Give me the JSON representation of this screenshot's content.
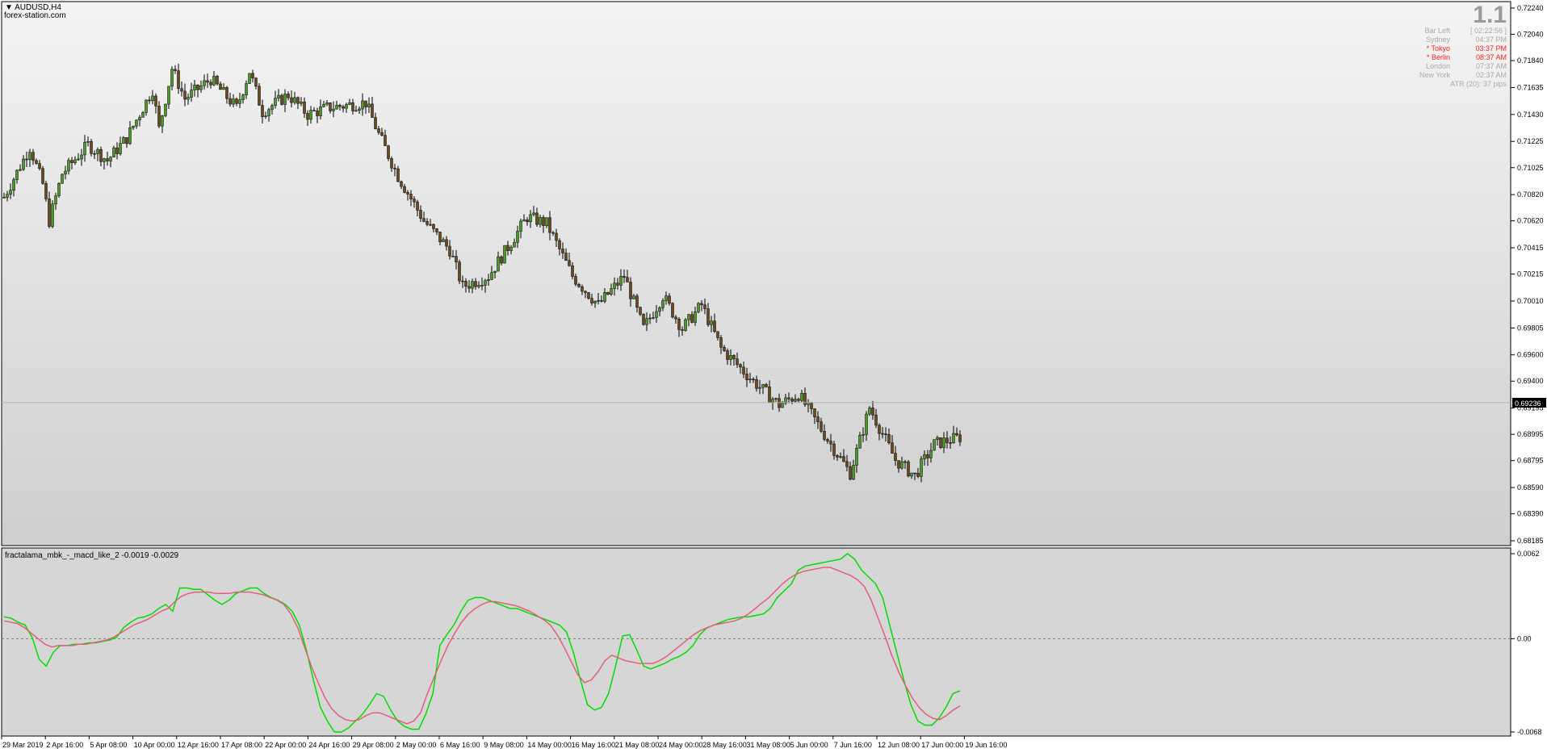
{
  "window": {
    "symbol": "AUDUSD,H4",
    "broker": "forex-station.com",
    "spread": "1.1"
  },
  "sessions": {
    "rows": [
      {
        "label": "Bar Left",
        "value": "[ 02:22:56 ]",
        "color": "#a9a9a9"
      },
      {
        "label": "Sydney",
        "value": "04:37 PM",
        "color": "#a9a9a9"
      },
      {
        "label": "* Tokyo",
        "value": "03:37 PM",
        "color": "#ff2020"
      },
      {
        "label": "* Berlin",
        "value": "08:37 AM",
        "color": "#ff2020"
      },
      {
        "label": "London",
        "value": "07:37 AM",
        "color": "#a9a9a9"
      },
      {
        "label": "New York",
        "value": "02:37 AM",
        "color": "#a9a9a9"
      }
    ],
    "atr": "ATR (20): 37 pips"
  },
  "indicator": {
    "title": "fractalama_mbk_-_macd_like_2 -0.0019 -0.0029"
  },
  "chart_data": [
    {
      "type": "candlestick",
      "title": "AUDUSD,H4",
      "ylim": [
        0.68185,
        0.7224
      ],
      "y_ticks": [
        "0.72240",
        "0.72040",
        "0.71840",
        "0.71635",
        "0.71430",
        "0.71225",
        "0.71025",
        "0.70820",
        "0.70620",
        "0.70415",
        "0.70215",
        "0.70010",
        "0.69805",
        "0.69600",
        "0.69400",
        "0.69195",
        "0.68995",
        "0.68795",
        "0.68590",
        "0.68390",
        "0.68185"
      ],
      "current_price": "0.69236",
      "bar_count": 297,
      "bullish_color": "#4c9a2a",
      "bearish_color": "#6b4a1e",
      "anchors": [
        [
          0,
          0.708
        ],
        [
          8,
          0.7118
        ],
        [
          12,
          0.709
        ],
        [
          14,
          0.7062
        ],
        [
          18,
          0.7098
        ],
        [
          26,
          0.712
        ],
        [
          32,
          0.7108
        ],
        [
          38,
          0.7125
        ],
        [
          46,
          0.7162
        ],
        [
          48,
          0.7132
        ],
        [
          52,
          0.7178
        ],
        [
          56,
          0.7155
        ],
        [
          64,
          0.717
        ],
        [
          72,
          0.7148
        ],
        [
          76,
          0.7176
        ],
        [
          80,
          0.7145
        ],
        [
          88,
          0.7158
        ],
        [
          94,
          0.7143
        ],
        [
          100,
          0.7148
        ],
        [
          112,
          0.7152
        ],
        [
          116,
          0.7128
        ],
        [
          122,
          0.7096
        ],
        [
          130,
          0.7062
        ],
        [
          138,
          0.704
        ],
        [
          142,
          0.7012
        ],
        [
          150,
          0.702
        ],
        [
          156,
          0.7042
        ],
        [
          162,
          0.7065
        ],
        [
          168,
          0.706
        ],
        [
          176,
          0.702
        ],
        [
          184,
          0.6998
        ],
        [
          192,
          0.702
        ],
        [
          198,
          0.698
        ],
        [
          204,
          0.7005
        ],
        [
          210,
          0.698
        ],
        [
          216,
          0.6998
        ],
        [
          222,
          0.6965
        ],
        [
          232,
          0.694
        ],
        [
          240,
          0.6922
        ],
        [
          246,
          0.693
        ],
        [
          256,
          0.6892
        ],
        [
          262,
          0.687
        ],
        [
          268,
          0.692
        ],
        [
          276,
          0.688
        ],
        [
          282,
          0.6868
        ],
        [
          288,
          0.6892
        ],
        [
          297,
          0.6898
        ]
      ]
    },
    {
      "type": "line",
      "title": "fractalama_mbk_-_macd_like_2 -0.0019 -0.0029",
      "ylim": [
        -0.0068,
        0.0062
      ],
      "y_ticks": [
        "0.0062",
        "0.00",
        "-0.0068"
      ],
      "zero_line": 0.0,
      "series": [
        {
          "color": "#00dd00",
          "values": [
            0.0016,
            0.0015,
            0.0012,
            0.001,
            0.0001,
            -0.0015,
            -0.002,
            -0.001,
            -0.0005,
            -0.0005,
            -0.0004,
            -0.0004,
            -0.0003,
            -0.0003,
            -0.0002,
            -0.0001,
            0.0001,
            0.0008,
            0.0012,
            0.0015,
            0.0016,
            0.0018,
            0.0022,
            0.0025,
            0.002,
            0.0037,
            0.0037,
            0.0036,
            0.0036,
            0.0032,
            0.0028,
            0.0025,
            0.0028,
            0.0033,
            0.0035,
            0.0037,
            0.0037,
            0.0033,
            0.003,
            0.0028,
            0.0025,
            0.002,
            0.001,
            -0.0008,
            -0.003,
            -0.005,
            -0.006,
            -0.0068,
            -0.0068,
            -0.0065,
            -0.006,
            -0.0055,
            -0.0048,
            -0.004,
            -0.0042,
            -0.0052,
            -0.006,
            -0.0064,
            -0.0066,
            -0.0066,
            -0.0055,
            -0.004,
            -0.0005,
            0.0003,
            0.001,
            0.002,
            0.0028,
            0.003,
            0.003,
            0.0028,
            0.0026,
            0.0024,
            0.0022,
            0.0022,
            0.002,
            0.0018,
            0.0016,
            0.0014,
            0.0012,
            0.001,
            0.0005,
            -0.001,
            -0.003,
            -0.0048,
            -0.0052,
            -0.005,
            -0.004,
            -0.002,
            0.0002,
            0.0003,
            -0.0008,
            -0.002,
            -0.0022,
            -0.002,
            -0.0018,
            -0.0015,
            -0.0013,
            -0.001,
            -0.0005,
            0.0003,
            0.0008,
            0.001,
            0.0012,
            0.0014,
            0.0015,
            0.0016,
            0.0016,
            0.0017,
            0.0018,
            0.0022,
            0.003,
            0.0035,
            0.004,
            0.005,
            0.0053,
            0.0054,
            0.0055,
            0.0056,
            0.0057,
            0.0058,
            0.0062,
            0.0058,
            0.005,
            0.0045,
            0.004,
            0.003,
            0.001,
            -0.001,
            -0.003,
            -0.0048,
            -0.006,
            -0.0063,
            -0.0063,
            -0.0058,
            -0.005,
            -0.004,
            -0.0038
          ]
        },
        {
          "color": "#e0607a",
          "values": [
            0.0013,
            0.0012,
            0.0011,
            0.0008,
            0.0004,
            0.0,
            -0.0004,
            -0.0006,
            -0.0005,
            -0.0005,
            -0.0005,
            -0.0004,
            -0.0004,
            -0.0003,
            -0.0002,
            -0.0001,
            0.0001,
            0.0004,
            0.0007,
            0.001,
            0.0012,
            0.0014,
            0.0017,
            0.002,
            0.0022,
            0.0027,
            0.0031,
            0.0033,
            0.0034,
            0.0034,
            0.0034,
            0.0033,
            0.0033,
            0.0033,
            0.0034,
            0.0034,
            0.0034,
            0.0033,
            0.0032,
            0.003,
            0.0028,
            0.0025,
            0.0018,
            0.0008,
            -0.0006,
            -0.002,
            -0.0032,
            -0.0043,
            -0.0051,
            -0.0056,
            -0.0059,
            -0.006,
            -0.0059,
            -0.0056,
            -0.0054,
            -0.0054,
            -0.0056,
            -0.0058,
            -0.006,
            -0.0062,
            -0.006,
            -0.0054,
            -0.004,
            -0.0028,
            -0.0016,
            -0.0005,
            0.0004,
            0.0012,
            0.0018,
            0.0022,
            0.0025,
            0.0027,
            0.0027,
            0.0026,
            0.0025,
            0.0024,
            0.0022,
            0.002,
            0.0017,
            0.0014,
            0.001,
            0.0003,
            -0.0006,
            -0.0016,
            -0.0026,
            -0.0032,
            -0.003,
            -0.0024,
            -0.0016,
            -0.0012,
            -0.0014,
            -0.0016,
            -0.0017,
            -0.0018,
            -0.0018,
            -0.0018,
            -0.0016,
            -0.0013,
            -0.0009,
            -0.0005,
            -0.0001,
            0.0003,
            0.0006,
            0.0008,
            0.001,
            0.0011,
            0.0012,
            0.0013,
            0.0015,
            0.0018,
            0.0022,
            0.0026,
            0.003,
            0.0035,
            0.004,
            0.0044,
            0.0047,
            0.0049,
            0.005,
            0.0051,
            0.0052,
            0.0052,
            0.005,
            0.0048,
            0.0046,
            0.0043,
            0.0038,
            0.0028,
            0.0015,
            0.0002,
            -0.0012,
            -0.0024,
            -0.0034,
            -0.0043,
            -0.005,
            -0.0055,
            -0.0058,
            -0.0059,
            -0.0056,
            -0.0052,
            -0.0049
          ]
        }
      ]
    }
  ],
  "x_axis_labels": [
    "29 Mar 2019",
    "2 Apr 16:00",
    "5 Apr 08:00",
    "10 Apr 00:00",
    "12 Apr 16:00",
    "17 Apr 08:00",
    "22 Apr 00:00",
    "24 Apr 16:00",
    "29 Apr 08:00",
    "2 May 00:00",
    "6 May 16:00",
    "9 May 08:00",
    "14 May 00:00",
    "16 May 16:00",
    "21 May 08:00",
    "24 May 00:00",
    "28 May 16:00",
    "31 May 08:00",
    "5 Jun 00:00",
    "7 Jun 16:00",
    "12 Jun 08:00",
    "17 Jun 00:00",
    "19 Jun 16:00"
  ]
}
